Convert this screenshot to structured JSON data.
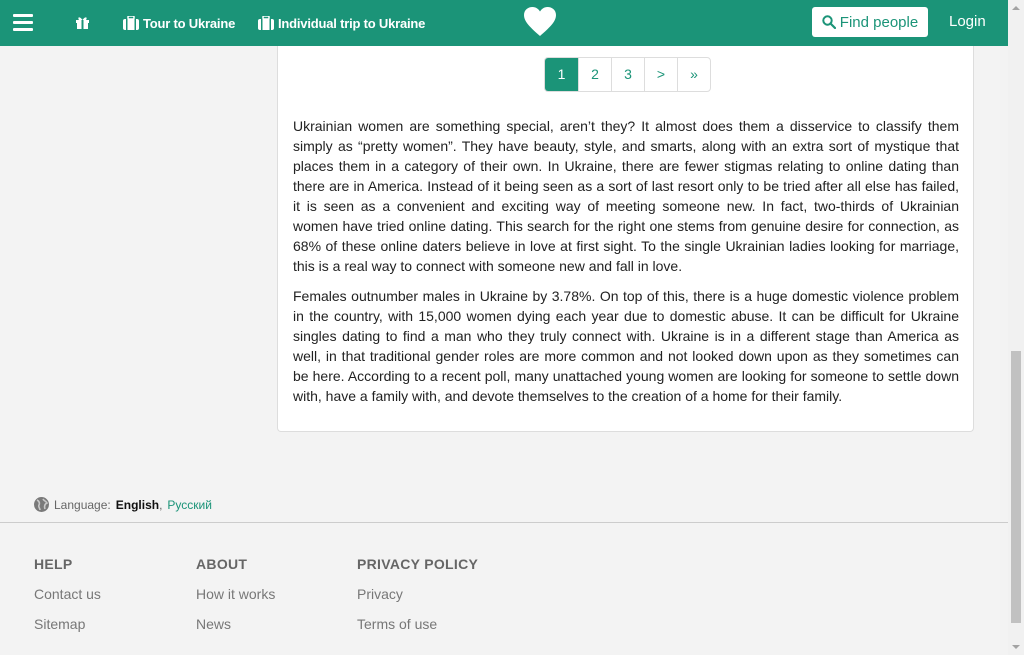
{
  "header": {
    "tour_label": "Tour to Ukraine",
    "trip_label": "Individual trip to Ukraine",
    "find_label": "Find people",
    "login_label": "Login"
  },
  "pagination": {
    "pages": [
      "1",
      "2",
      "3",
      ">",
      "»"
    ],
    "active": "1"
  },
  "content": {
    "paragraphs": [
      "Ukrainian women are something special, aren’t they? It almost does them a disservice to classify them simply as “pretty women”. They have beauty, style, and smarts, along with an extra sort of mystique that places them in a category of their own. In Ukraine, there are fewer stigmas relating to online dating than there are in America. Instead of it being seen as a sort of last resort only to be tried after all else has failed, it is seen as a convenient and exciting way of meeting someone new. In fact, two-thirds of Ukrainian women have tried online dating. This search for the right one stems from genuine desire for connection, as 68% of these online daters believe in love at first sight. To the single Ukrainian ladies looking for marriage, this is a real way to connect with someone new and fall in love.",
      "Females outnumber males in Ukraine by 3.78%. On top of this, there is a huge domestic violence problem in the country, with 15,000 women dying each year due to domestic abuse. It can be difficult for Ukraine singles dating to find a man who they truly connect with. Ukraine is in a different stage than America as well, in that traditional gender roles are more common and not looked down upon as they sometimes can be here. According to a recent poll, many unattached young women are looking for someone to settle down with, have a family with, and devote themselves to the creation of a home for their family."
    ]
  },
  "language": {
    "label": "Language:",
    "current": "English",
    "separator": ",",
    "alternate": "Русский"
  },
  "footer": {
    "help": {
      "title": "HELP",
      "links": [
        "Contact us",
        "Sitemap"
      ]
    },
    "about": {
      "title": "ABOUT",
      "links": [
        "How it works",
        "News"
      ]
    },
    "privacy": {
      "title": "PRIVACY POLICY",
      "links": [
        "Privacy",
        "Terms of use"
      ]
    }
  },
  "colors": {
    "brand": "#1b9478"
  },
  "icons": [
    "menu-icon",
    "gift-icon",
    "suitcase-icon",
    "heart-logo-icon",
    "search-icon",
    "globe-icon"
  ]
}
